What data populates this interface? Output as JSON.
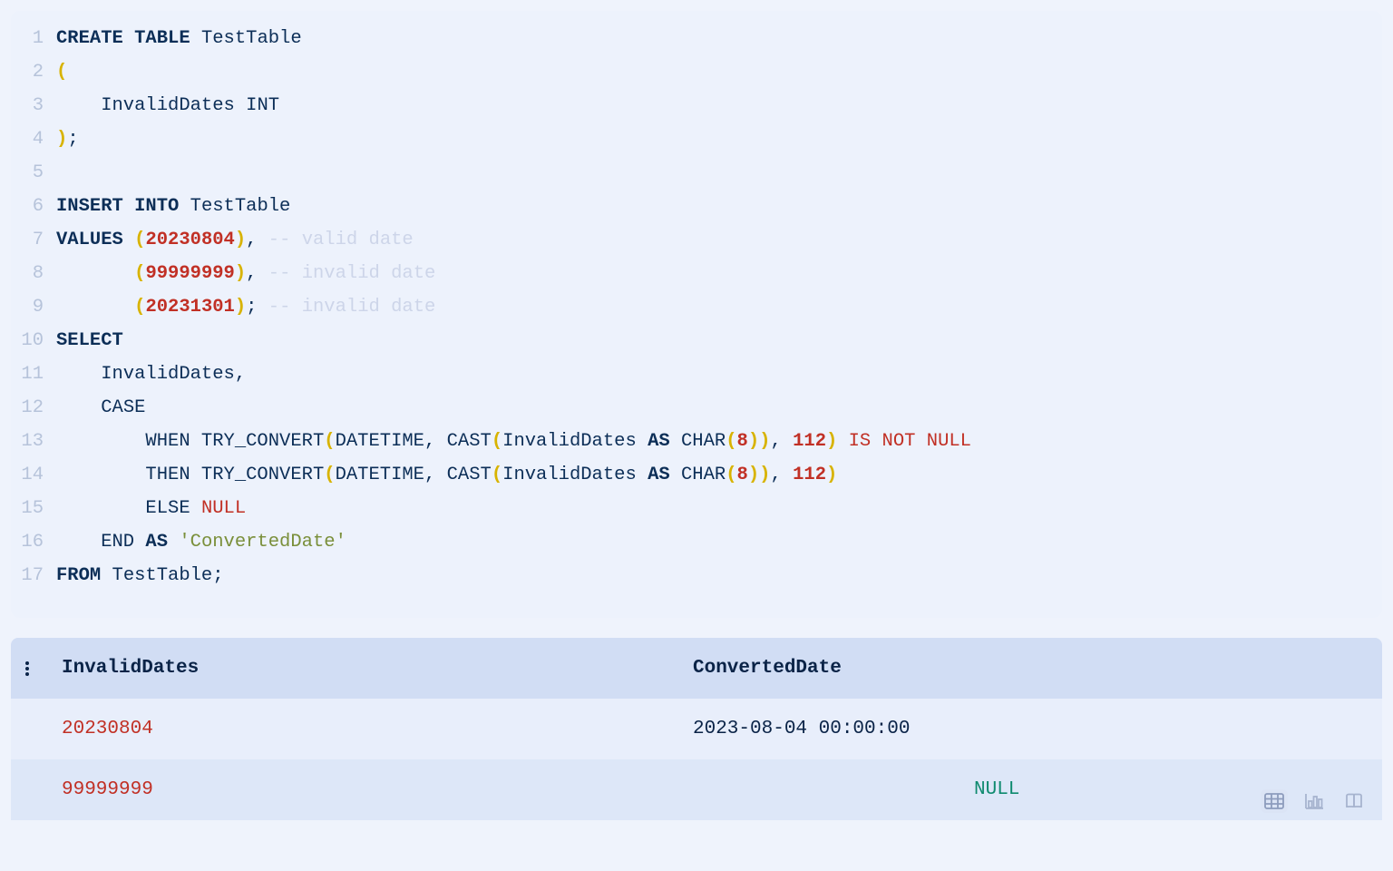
{
  "editor": {
    "lines": [
      {
        "n": 1,
        "tokens": [
          {
            "t": "CREATE",
            "c": "kw"
          },
          {
            "t": " ",
            "c": "id"
          },
          {
            "t": "TABLE",
            "c": "kw"
          },
          {
            "t": " TestTable",
            "c": "id"
          }
        ]
      },
      {
        "n": 2,
        "tokens": [
          {
            "t": "(",
            "c": "py"
          }
        ]
      },
      {
        "n": 3,
        "tokens": [
          {
            "t": "    InvalidDates ",
            "c": "id"
          },
          {
            "t": "INT",
            "c": "id"
          }
        ]
      },
      {
        "n": 4,
        "tokens": [
          {
            "t": ")",
            "c": "py"
          },
          {
            "t": ";",
            "c": "pn"
          }
        ]
      },
      {
        "n": 5,
        "tokens": [
          {
            "t": "",
            "c": "id"
          }
        ]
      },
      {
        "n": 6,
        "tokens": [
          {
            "t": "INSERT",
            "c": "kw"
          },
          {
            "t": " ",
            "c": "id"
          },
          {
            "t": "INTO",
            "c": "kw"
          },
          {
            "t": " TestTable",
            "c": "id"
          }
        ]
      },
      {
        "n": 7,
        "tokens": [
          {
            "t": "VALUES",
            "c": "kw"
          },
          {
            "t": " ",
            "c": "id"
          },
          {
            "t": "(",
            "c": "py"
          },
          {
            "t": "20230804",
            "c": "num"
          },
          {
            "t": ")",
            "c": "py"
          },
          {
            "t": ",",
            "c": "pn"
          },
          {
            "t": " ",
            "c": "id"
          },
          {
            "t": "-- valid date",
            "c": "cm"
          }
        ]
      },
      {
        "n": 8,
        "tokens": [
          {
            "t": "       ",
            "c": "id"
          },
          {
            "t": "(",
            "c": "py"
          },
          {
            "t": "99999999",
            "c": "num"
          },
          {
            "t": ")",
            "c": "py"
          },
          {
            "t": ",",
            "c": "pn"
          },
          {
            "t": " ",
            "c": "id"
          },
          {
            "t": "-- invalid date",
            "c": "cm"
          }
        ]
      },
      {
        "n": 9,
        "tokens": [
          {
            "t": "       ",
            "c": "id"
          },
          {
            "t": "(",
            "c": "py"
          },
          {
            "t": "20231301",
            "c": "num"
          },
          {
            "t": ")",
            "c": "py"
          },
          {
            "t": ";",
            "c": "pn"
          },
          {
            "t": " ",
            "c": "id"
          },
          {
            "t": "-- invalid date",
            "c": "cm"
          }
        ]
      },
      {
        "n": 10,
        "tokens": [
          {
            "t": "SELECT",
            "c": "kw"
          }
        ]
      },
      {
        "n": 11,
        "tokens": [
          {
            "t": "    InvalidDates",
            "c": "id"
          },
          {
            "t": ",",
            "c": "pn"
          }
        ]
      },
      {
        "n": 12,
        "tokens": [
          {
            "t": "    ",
            "c": "id"
          },
          {
            "t": "CASE",
            "c": "id"
          }
        ]
      },
      {
        "n": 13,
        "tokens": [
          {
            "t": "        WHEN TRY_CONVERT",
            "c": "id"
          },
          {
            "t": "(",
            "c": "py"
          },
          {
            "t": "DATETIME",
            "c": "id"
          },
          {
            "t": ",",
            "c": "pn"
          },
          {
            "t": " ",
            "c": "id"
          },
          {
            "t": "CAST",
            "c": "id"
          },
          {
            "t": "(",
            "c": "py"
          },
          {
            "t": "InvalidDates ",
            "c": "id"
          },
          {
            "t": "AS",
            "c": "kw"
          },
          {
            "t": " ",
            "c": "id"
          },
          {
            "t": "CHAR",
            "c": "id"
          },
          {
            "t": "(",
            "c": "py"
          },
          {
            "t": "8",
            "c": "num"
          },
          {
            "t": ")",
            "c": "py"
          },
          {
            "t": ")",
            "c": "py"
          },
          {
            "t": ",",
            "c": "pn"
          },
          {
            "t": " ",
            "c": "id"
          },
          {
            "t": "112",
            "c": "num"
          },
          {
            "t": ")",
            "c": "py"
          },
          {
            "t": " ",
            "c": "id"
          },
          {
            "t": "IS",
            "c": "fnr"
          },
          {
            "t": " ",
            "c": "id"
          },
          {
            "t": "NOT",
            "c": "fnr"
          },
          {
            "t": " ",
            "c": "id"
          },
          {
            "t": "NULL",
            "c": "fnr"
          }
        ]
      },
      {
        "n": 14,
        "tokens": [
          {
            "t": "        THEN TRY_CONVERT",
            "c": "id"
          },
          {
            "t": "(",
            "c": "py"
          },
          {
            "t": "DATETIME",
            "c": "id"
          },
          {
            "t": ",",
            "c": "pn"
          },
          {
            "t": " ",
            "c": "id"
          },
          {
            "t": "CAST",
            "c": "id"
          },
          {
            "t": "(",
            "c": "py"
          },
          {
            "t": "InvalidDates ",
            "c": "id"
          },
          {
            "t": "AS",
            "c": "kw"
          },
          {
            "t": " ",
            "c": "id"
          },
          {
            "t": "CHAR",
            "c": "id"
          },
          {
            "t": "(",
            "c": "py"
          },
          {
            "t": "8",
            "c": "num"
          },
          {
            "t": ")",
            "c": "py"
          },
          {
            "t": ")",
            "c": "py"
          },
          {
            "t": ",",
            "c": "pn"
          },
          {
            "t": " ",
            "c": "id"
          },
          {
            "t": "112",
            "c": "num"
          },
          {
            "t": ")",
            "c": "py"
          }
        ]
      },
      {
        "n": 15,
        "tokens": [
          {
            "t": "        ELSE ",
            "c": "id"
          },
          {
            "t": "NULL",
            "c": "nul"
          }
        ]
      },
      {
        "n": 16,
        "tokens": [
          {
            "t": "    END ",
            "c": "id"
          },
          {
            "t": "AS",
            "c": "kw"
          },
          {
            "t": " ",
            "c": "id"
          },
          {
            "t": "'ConvertedDate'",
            "c": "str"
          }
        ]
      },
      {
        "n": 17,
        "tokens": [
          {
            "t": "FROM",
            "c": "kw"
          },
          {
            "t": " TestTable",
            "c": "id"
          },
          {
            "t": ";",
            "c": "pn"
          }
        ]
      }
    ]
  },
  "results": {
    "columns": [
      "InvalidDates",
      "ConvertedDate"
    ],
    "rows": [
      {
        "InvalidDates": "20230804",
        "ConvertedDate": "2023-08-04 00:00:00",
        "null2": false
      },
      {
        "InvalidDates": "99999999",
        "ConvertedDate": "NULL",
        "null2": true
      }
    ]
  },
  "icons": {
    "table": "table-view",
    "chart": "chart-view",
    "book": "docs-view"
  }
}
